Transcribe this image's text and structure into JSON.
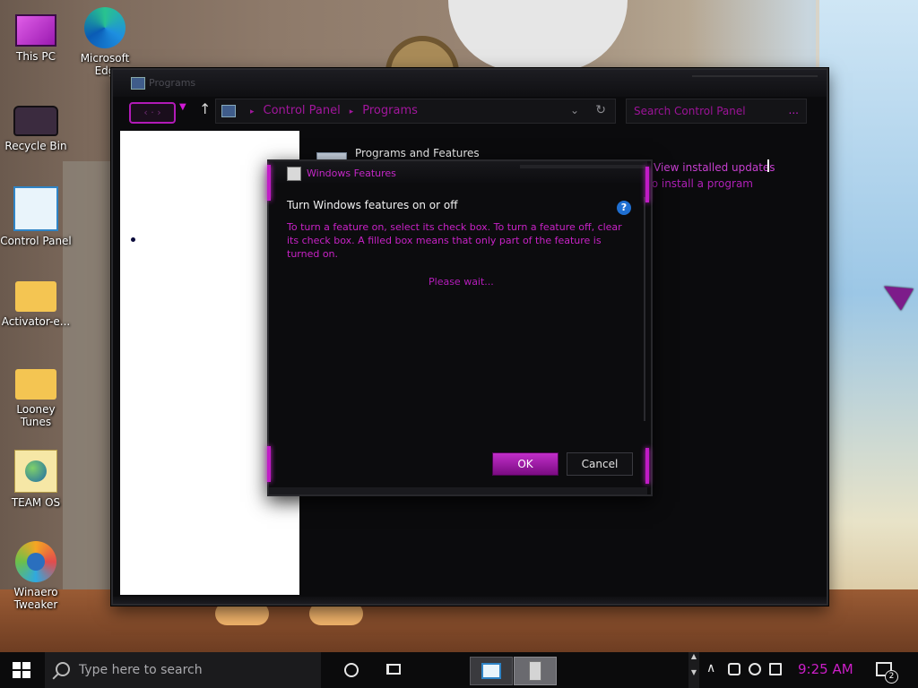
{
  "desktop": {
    "icons": [
      {
        "label": "This PC",
        "icon": "monitor-icon"
      },
      {
        "label": "Microsoft Edg",
        "icon": "edge-icon"
      },
      {
        "label": "Recycle Bin",
        "icon": "recycle-bin-icon"
      },
      {
        "label": "Control Panel",
        "icon": "control-panel-icon"
      },
      {
        "label": "Activator-e...",
        "icon": "folder-icon"
      },
      {
        "label": "Looney Tunes",
        "icon": "folder-icon"
      },
      {
        "label": "TEAM OS",
        "icon": "globe-icon"
      },
      {
        "label": "Winaero Tweaker",
        "icon": "winaero-icon"
      }
    ]
  },
  "explorer": {
    "title": "Programs",
    "back_forward": "‹ · ›",
    "breadcrumb": [
      "Control Panel",
      "Programs"
    ],
    "search_placeholder": "Search Control Panel",
    "search_ellipsis": "...",
    "section_title": "Programs and Features",
    "link_view_updates": "View installed updates",
    "link_install": "to install a program"
  },
  "dialog": {
    "title": "Windows Features",
    "heading": "Turn Windows features on or off",
    "help": "?",
    "description": "To turn a feature on, select its check box. To turn a feature off, clear its check box. A filled box means that only part of the feature is turned on.",
    "status": "Please wait...",
    "ok_label": "OK",
    "cancel_label": "Cancel"
  },
  "taskbar": {
    "search_placeholder": "Type here to search",
    "time": "9:25 AM",
    "notification_count": "2"
  },
  "colors": {
    "accent": "#c11bc6",
    "window_bg": "#0b0b0d",
    "taskbar_bg": "#0b0b0c"
  }
}
